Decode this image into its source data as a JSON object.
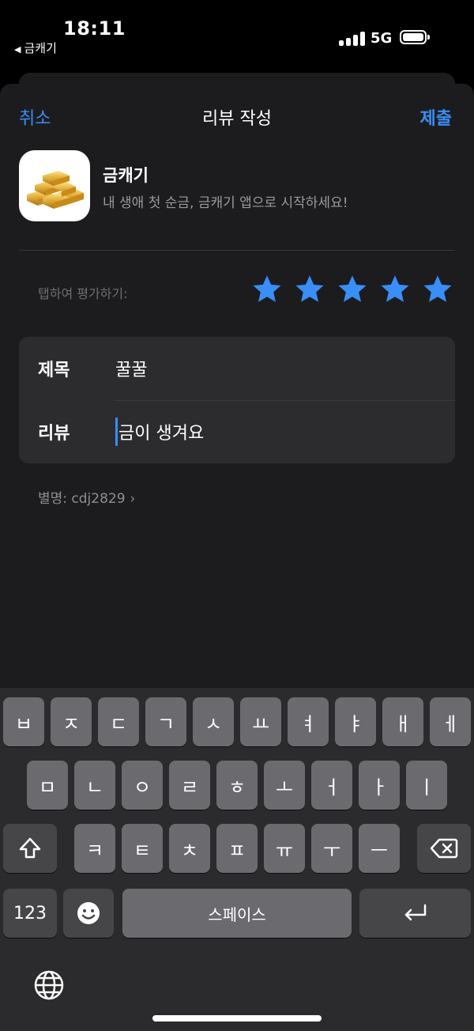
{
  "status_bar": {
    "time": "18:11",
    "back_app": "금캐기",
    "network": "5G"
  },
  "nav": {
    "cancel": "취소",
    "title": "리뷰 작성",
    "submit": "제출"
  },
  "app": {
    "name": "금캐기",
    "subtitle": "내 생애 첫 순금, 금캐기 앱으로 시작하세요!",
    "icon": "gold-bars-icon"
  },
  "rating": {
    "hint": "탭하여 평가하기:",
    "stars": 5,
    "max": 5
  },
  "form": {
    "title_label": "제목",
    "title_value": "꿀꿀",
    "review_label": "리뷰",
    "review_value": "금이 생겨요"
  },
  "nickname": {
    "text": "별명: cdj2829",
    "chevron": "›"
  },
  "keyboard": {
    "row1": [
      "ㅂ",
      "ㅈ",
      "ㄷ",
      "ㄱ",
      "ㅅ",
      "ㅛ",
      "ㅕ",
      "ㅑ",
      "ㅐ",
      "ㅔ"
    ],
    "row2": [
      "ㅁ",
      "ㄴ",
      "ㅇ",
      "ㄹ",
      "ㅎ",
      "ㅗ",
      "ㅓ",
      "ㅏ",
      "ㅣ"
    ],
    "row3": [
      "ㅋ",
      "ㅌ",
      "ㅊ",
      "ㅍ",
      "ㅠ",
      "ㅜ",
      "ㅡ"
    ],
    "numbers": "123",
    "space": "스페이스"
  },
  "colors": {
    "accent": "#3a8ef7",
    "sheet": "#1c1c1e",
    "card": "#2c2c2e",
    "key": "#6b6b6f",
    "key_dark": "#464649",
    "gold": "#e7b53a"
  }
}
